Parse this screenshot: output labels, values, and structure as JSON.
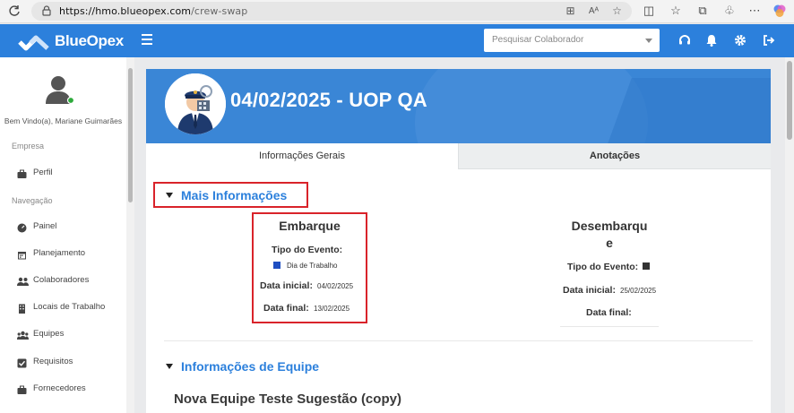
{
  "browser": {
    "url_host": "https://hmo.blueopex.com",
    "url_path": "/crew-swap"
  },
  "header": {
    "brand": "BlueOpex",
    "search_placeholder": "Pesquisar Colaborador",
    "accent_color": "#2c80dc"
  },
  "sidebar": {
    "welcome": "Bem Vindo(a), Mariane Guimarães",
    "section_empresa": "Empresa",
    "section_navegacao": "Navegação",
    "items": [
      {
        "label": "Perfil",
        "icon": "briefcase-icon"
      },
      {
        "label": "Painel",
        "icon": "dashboard-icon"
      },
      {
        "label": "Planejamento",
        "icon": "calendar-icon"
      },
      {
        "label": "Colaboradores",
        "icon": "users-icon"
      },
      {
        "label": "Locais de Trabalho",
        "icon": "building-icon"
      },
      {
        "label": "Equipes",
        "icon": "team-icon"
      },
      {
        "label": "Requisitos",
        "icon": "checkbox-icon"
      },
      {
        "label": "Fornecedores",
        "icon": "briefcase-icon"
      }
    ]
  },
  "main": {
    "title": "04/02/2025 - UOP QA",
    "tabs": [
      {
        "label": "Informações Gerais",
        "active": true
      },
      {
        "label": "Anotações",
        "active": false
      }
    ],
    "mais_info_title": "Mais Informações",
    "embarque": {
      "title": "Embarque",
      "tipo_label": "Tipo do Evento:",
      "tipo_value": "Dia de Trabalho",
      "tipo_color": "#1f4fc2",
      "inicial_label": "Data inicial:",
      "inicial_value": "04/02/2025",
      "final_label": "Data final:",
      "final_value": "13/02/2025"
    },
    "desembarque": {
      "title_line1": "Desembarqu",
      "title_line2": "e",
      "tipo_label": "Tipo do Evento:",
      "tipo_color": "#333333",
      "inicial_label": "Data inicial:",
      "inicial_value": "25/02/2025",
      "final_label": "Data final:"
    },
    "equipe_title": "Informações de Equipe",
    "team_name": "Nova Equipe Teste Sugestão (copy)"
  }
}
